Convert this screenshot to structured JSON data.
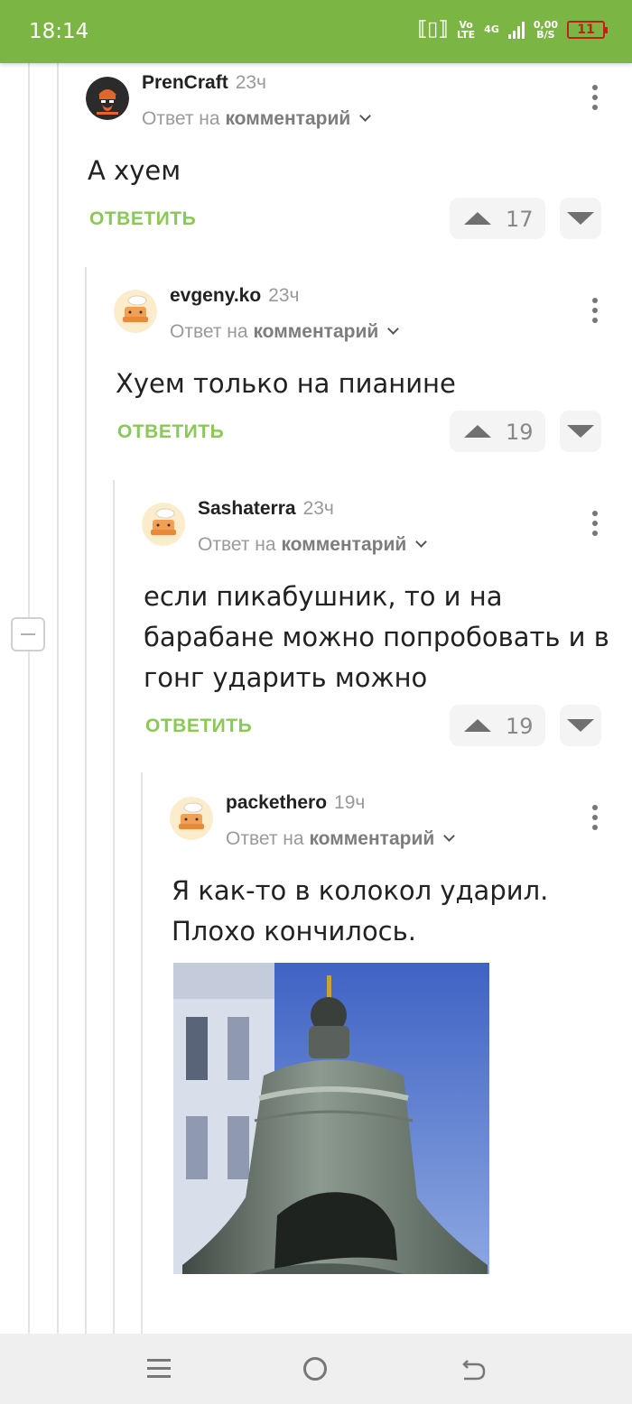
{
  "status_bar": {
    "time": "18:14",
    "net_top": "Vo",
    "net_bottom": "LTE",
    "signal": "4G",
    "speed_value": "0,00",
    "speed_unit": "B/S",
    "battery": "11"
  },
  "comments": [
    {
      "username": "PrenCraft",
      "time": "23ч",
      "reply_prefix": "Ответ на",
      "reply_target": "комментарий",
      "text_lines": [
        "А хуем"
      ],
      "reply_label": "ОТВЕТИТЬ",
      "votes": "17",
      "avatar": "dark-logo-avatar"
    },
    {
      "username": "evgeny.ko",
      "time": "23ч",
      "reply_prefix": "Ответ на",
      "reply_target": "комментарий",
      "text_lines": [
        "Хуем только на пианине"
      ],
      "reply_label": "ОТВЕТИТЬ",
      "votes": "19",
      "avatar": "default-cake-avatar"
    },
    {
      "username": "Sashaterra",
      "time": "23ч",
      "reply_prefix": "Ответ на",
      "reply_target": "комментарий",
      "text_lines": [
        "если пикабушник, то и на",
        "барабане можно попробовать и в",
        "гонг ударить можно"
      ],
      "reply_label": "ОТВЕТИТЬ",
      "votes": "19",
      "avatar": "default-cake-avatar"
    },
    {
      "username": "packethero",
      "time": "19ч",
      "reply_prefix": "Ответ на",
      "reply_target": "комментарий",
      "text_lines": [
        "Я как-то в колокол ударил.",
        "Плохо кончилось."
      ],
      "avatar": "default-cake-avatar",
      "image": "tsar-bell-photo"
    }
  ],
  "colors": {
    "brand_green": "#7bb543",
    "reply_green": "#8ac858",
    "battery_red": "#c0201a"
  },
  "icons": [
    "more-vertical-icon",
    "upvote-icon",
    "downvote-icon",
    "chevron-down-icon",
    "collapse-minus-icon",
    "menu-icon",
    "home-icon",
    "back-icon"
  ]
}
